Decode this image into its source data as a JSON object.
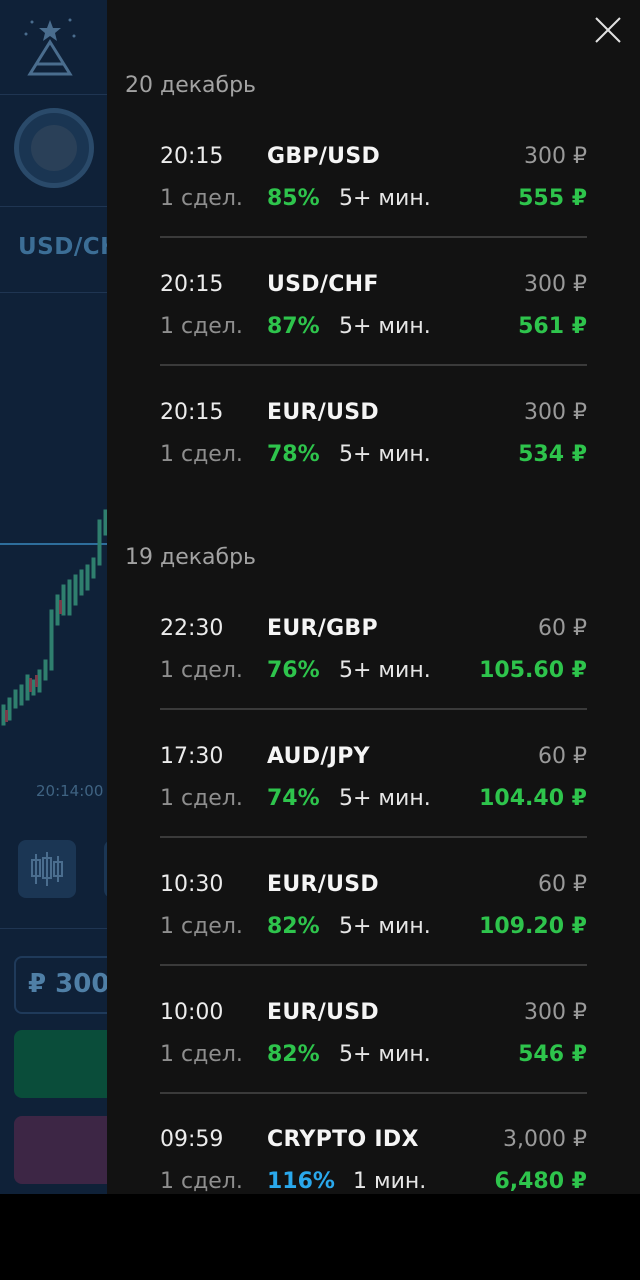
{
  "colors": {
    "drawer_bg": "#121212",
    "app_bg": "#0f2138",
    "profit_green": "#2ec44c",
    "percent_blue": "#2aa8ec",
    "muted_text": "#9a9a9a"
  },
  "background_app": {
    "pair_label": "USD/CH",
    "chart_time": "20:14:00",
    "amount": "₽ 300",
    "logo_icon": "tree-logo-icon",
    "candles_icon": "candlestick-icon"
  },
  "drawer": {
    "close_icon": "close-icon",
    "groups": [
      {
        "date": "20 декабрь",
        "trades": [
          {
            "time": "20:15",
            "pair": "GBP/USD",
            "stake": "300 ₽",
            "count": "1 сдел.",
            "percent": "85%",
            "duration": "5+ мин.",
            "payout": "555 ₽"
          },
          {
            "time": "20:15",
            "pair": "USD/CHF",
            "stake": "300 ₽",
            "count": "1 сдел.",
            "percent": "87%",
            "duration": "5+ мин.",
            "payout": "561 ₽"
          },
          {
            "time": "20:15",
            "pair": "EUR/USD",
            "stake": "300 ₽",
            "count": "1 сдел.",
            "percent": "78%",
            "duration": "5+ мин.",
            "payout": "534 ₽"
          }
        ]
      },
      {
        "date": "19 декабрь",
        "trades": [
          {
            "time": "22:30",
            "pair": "EUR/GBP",
            "stake": "60 ₽",
            "count": "1 сдел.",
            "percent": "76%",
            "duration": "5+ мин.",
            "payout": "105.60 ₽"
          },
          {
            "time": "17:30",
            "pair": "AUD/JPY",
            "stake": "60 ₽",
            "count": "1 сдел.",
            "percent": "74%",
            "duration": "5+ мин.",
            "payout": "104.40 ₽"
          },
          {
            "time": "10:30",
            "pair": "EUR/USD",
            "stake": "60 ₽",
            "count": "1 сдел.",
            "percent": "82%",
            "duration": "5+ мин.",
            "payout": "109.20 ₽"
          },
          {
            "time": "10:00",
            "pair": "EUR/USD",
            "stake": "300 ₽",
            "count": "1 сдел.",
            "percent": "82%",
            "duration": "5+ мин.",
            "payout": "546 ₽"
          },
          {
            "time": "09:59",
            "pair": "CRYPTO IDX",
            "stake": "3,000 ₽",
            "count": "1 сдел.",
            "percent": "116%",
            "duration": "1 мин.",
            "payout": "6,480 ₽"
          }
        ]
      }
    ]
  }
}
